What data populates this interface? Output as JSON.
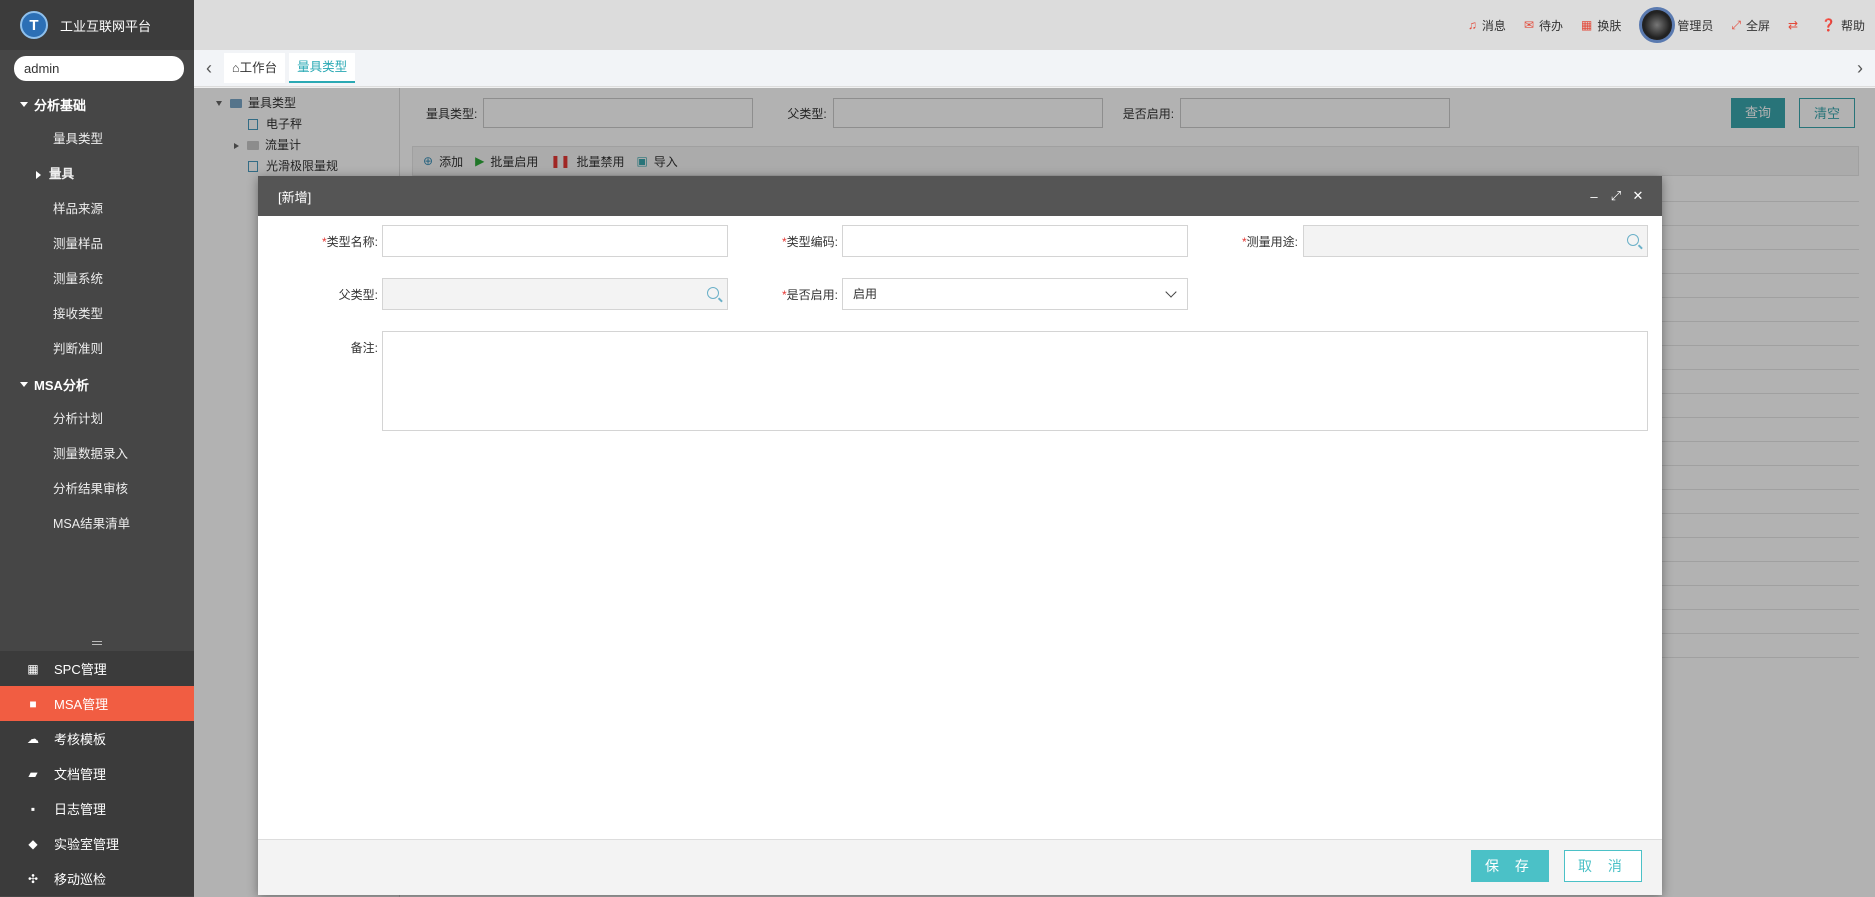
{
  "app": {
    "title": "工业互联网平台",
    "logo_letter": "T"
  },
  "user": {
    "name": "admin"
  },
  "sidebar": {
    "groups": [
      {
        "label": "分析基础",
        "items": [
          {
            "label": "量具类型"
          },
          {
            "label": "量具",
            "sub": true
          },
          {
            "label": "样品来源"
          },
          {
            "label": "测量样品"
          },
          {
            "label": "测量系统"
          },
          {
            "label": "接收类型"
          },
          {
            "label": "判断准则"
          }
        ]
      },
      {
        "label": "MSA分析",
        "items": [
          {
            "label": "分析计划"
          },
          {
            "label": "测量数据录入"
          },
          {
            "label": "分析结果审核"
          },
          {
            "label": "MSA结果清单"
          }
        ]
      }
    ],
    "bottom_nav": [
      {
        "label": "SPC管理",
        "icon": "grid-icon"
      },
      {
        "label": "MSA管理",
        "icon": "book-icon",
        "active": true
      },
      {
        "label": "考核模板",
        "icon": "cloud-icon"
      },
      {
        "label": "文档管理",
        "icon": "folder-icon"
      },
      {
        "label": "日志管理",
        "icon": "comment-icon"
      },
      {
        "label": "实验室管理",
        "icon": "graduation-cap-icon"
      },
      {
        "label": "移动巡检",
        "icon": "expand-icon"
      }
    ]
  },
  "header": {
    "messages": "消息",
    "todo": "待办",
    "skin": "换肤",
    "admin": "管理员",
    "fullscreen": "全屏",
    "help": "帮助",
    "accent": "#e34a3a"
  },
  "tabs": [
    {
      "label": "工作台",
      "icon": "home-icon"
    },
    {
      "label": "量具类型",
      "active": true
    }
  ],
  "tree": {
    "root": "量具类型",
    "nodes": [
      "电子秤",
      "流量计",
      "光滑极限量规"
    ]
  },
  "search": {
    "gauge_type_label": "量具类型:",
    "parent_type_label": "父类型:",
    "enabled_label": "是否启用:",
    "query_button": "查询",
    "clear_button": "清空"
  },
  "toolbar": {
    "add": "添加",
    "batch_enable": "批量启用",
    "batch_disable": "批量禁用",
    "import": "导入"
  },
  "modal": {
    "title": "[新增]",
    "type_name_label": "类型名称:",
    "type_code_label": "类型编码:",
    "purpose_label": "测量用途:",
    "parent_type_label": "父类型:",
    "enabled_label": "是否启用:",
    "enabled_value": "启用",
    "remark_label": "备注:",
    "required_mark": "*",
    "save_button": "保 存",
    "cancel_button": "取 消",
    "accent": "#4bc1c7"
  }
}
